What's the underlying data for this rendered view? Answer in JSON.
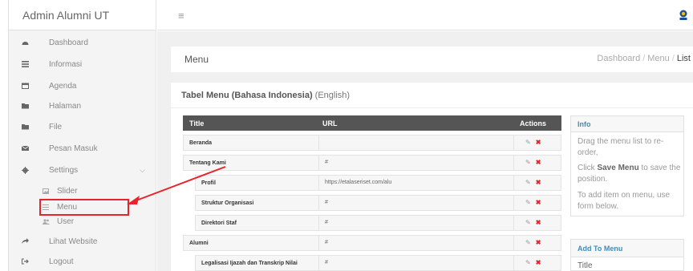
{
  "app": {
    "title": "Admin Alumni UT"
  },
  "topbar": {
    "menu_icon": "hamburger-icon",
    "logo_icon": "ut-logo-icon"
  },
  "sidebar": {
    "items": [
      {
        "label": "Dashboard",
        "icon": "dashboard-icon"
      },
      {
        "label": "Informasi",
        "icon": "list-icon"
      },
      {
        "label": "Agenda",
        "icon": "calendar-icon"
      },
      {
        "label": "Halaman",
        "icon": "folder-icon"
      },
      {
        "label": "File",
        "icon": "folder-icon"
      },
      {
        "label": "Pesan Masuk",
        "icon": "envelope-icon"
      },
      {
        "label": "Settings",
        "icon": "gear-icon"
      },
      {
        "label": "Lihat Website",
        "icon": "share-arrow-icon"
      },
      {
        "label": "Logout",
        "icon": "logout-icon"
      }
    ],
    "settings_sub": [
      {
        "label": "Slider",
        "icon": "image-icon"
      },
      {
        "label": "Menu",
        "icon": "menu-lines-icon"
      },
      {
        "label": "User",
        "icon": "users-icon"
      }
    ],
    "settings_chevron": "⌵"
  },
  "page": {
    "title": "Menu",
    "breadcrumb": [
      "Dashboard",
      "Menu",
      "List"
    ],
    "breadcrumb_sep": "/"
  },
  "panel": {
    "title_bold": "Tabel Menu (Bahasa Indonesia)",
    "title_sub": "(English)"
  },
  "table": {
    "headers": {
      "title": "Title",
      "url": "URL",
      "actions": "Actions"
    },
    "rows": [
      {
        "title": "Beranda",
        "url": ""
      },
      {
        "title": "Tentang Kami",
        "url": "#"
      },
      {
        "title": "Profil",
        "url": "https://etalaseriset.com/alu"
      },
      {
        "title": "Struktur Organisasi",
        "url": "#"
      },
      {
        "title": "Direktori Staf",
        "url": "#"
      },
      {
        "title": "Alumni",
        "url": "#"
      },
      {
        "title": "Legalisasi Ijazah dan Transkrip Nilai",
        "url": "#"
      }
    ],
    "edit_glyph": "✎",
    "delete_glyph": "✖"
  },
  "info": {
    "heading": "Info",
    "p1": "Drag the menu list to re-order,",
    "p2_pre": "Click ",
    "p2_bold": "Save Menu",
    "p2_post": " to save the position.",
    "p3": "To add item on menu, use form below."
  },
  "add_menu": {
    "heading": "Add To Menu",
    "field_label": "Title"
  },
  "colors": {
    "accent": "#3c8dbc",
    "highlight": "#e8242a",
    "table_head": "#555555"
  }
}
